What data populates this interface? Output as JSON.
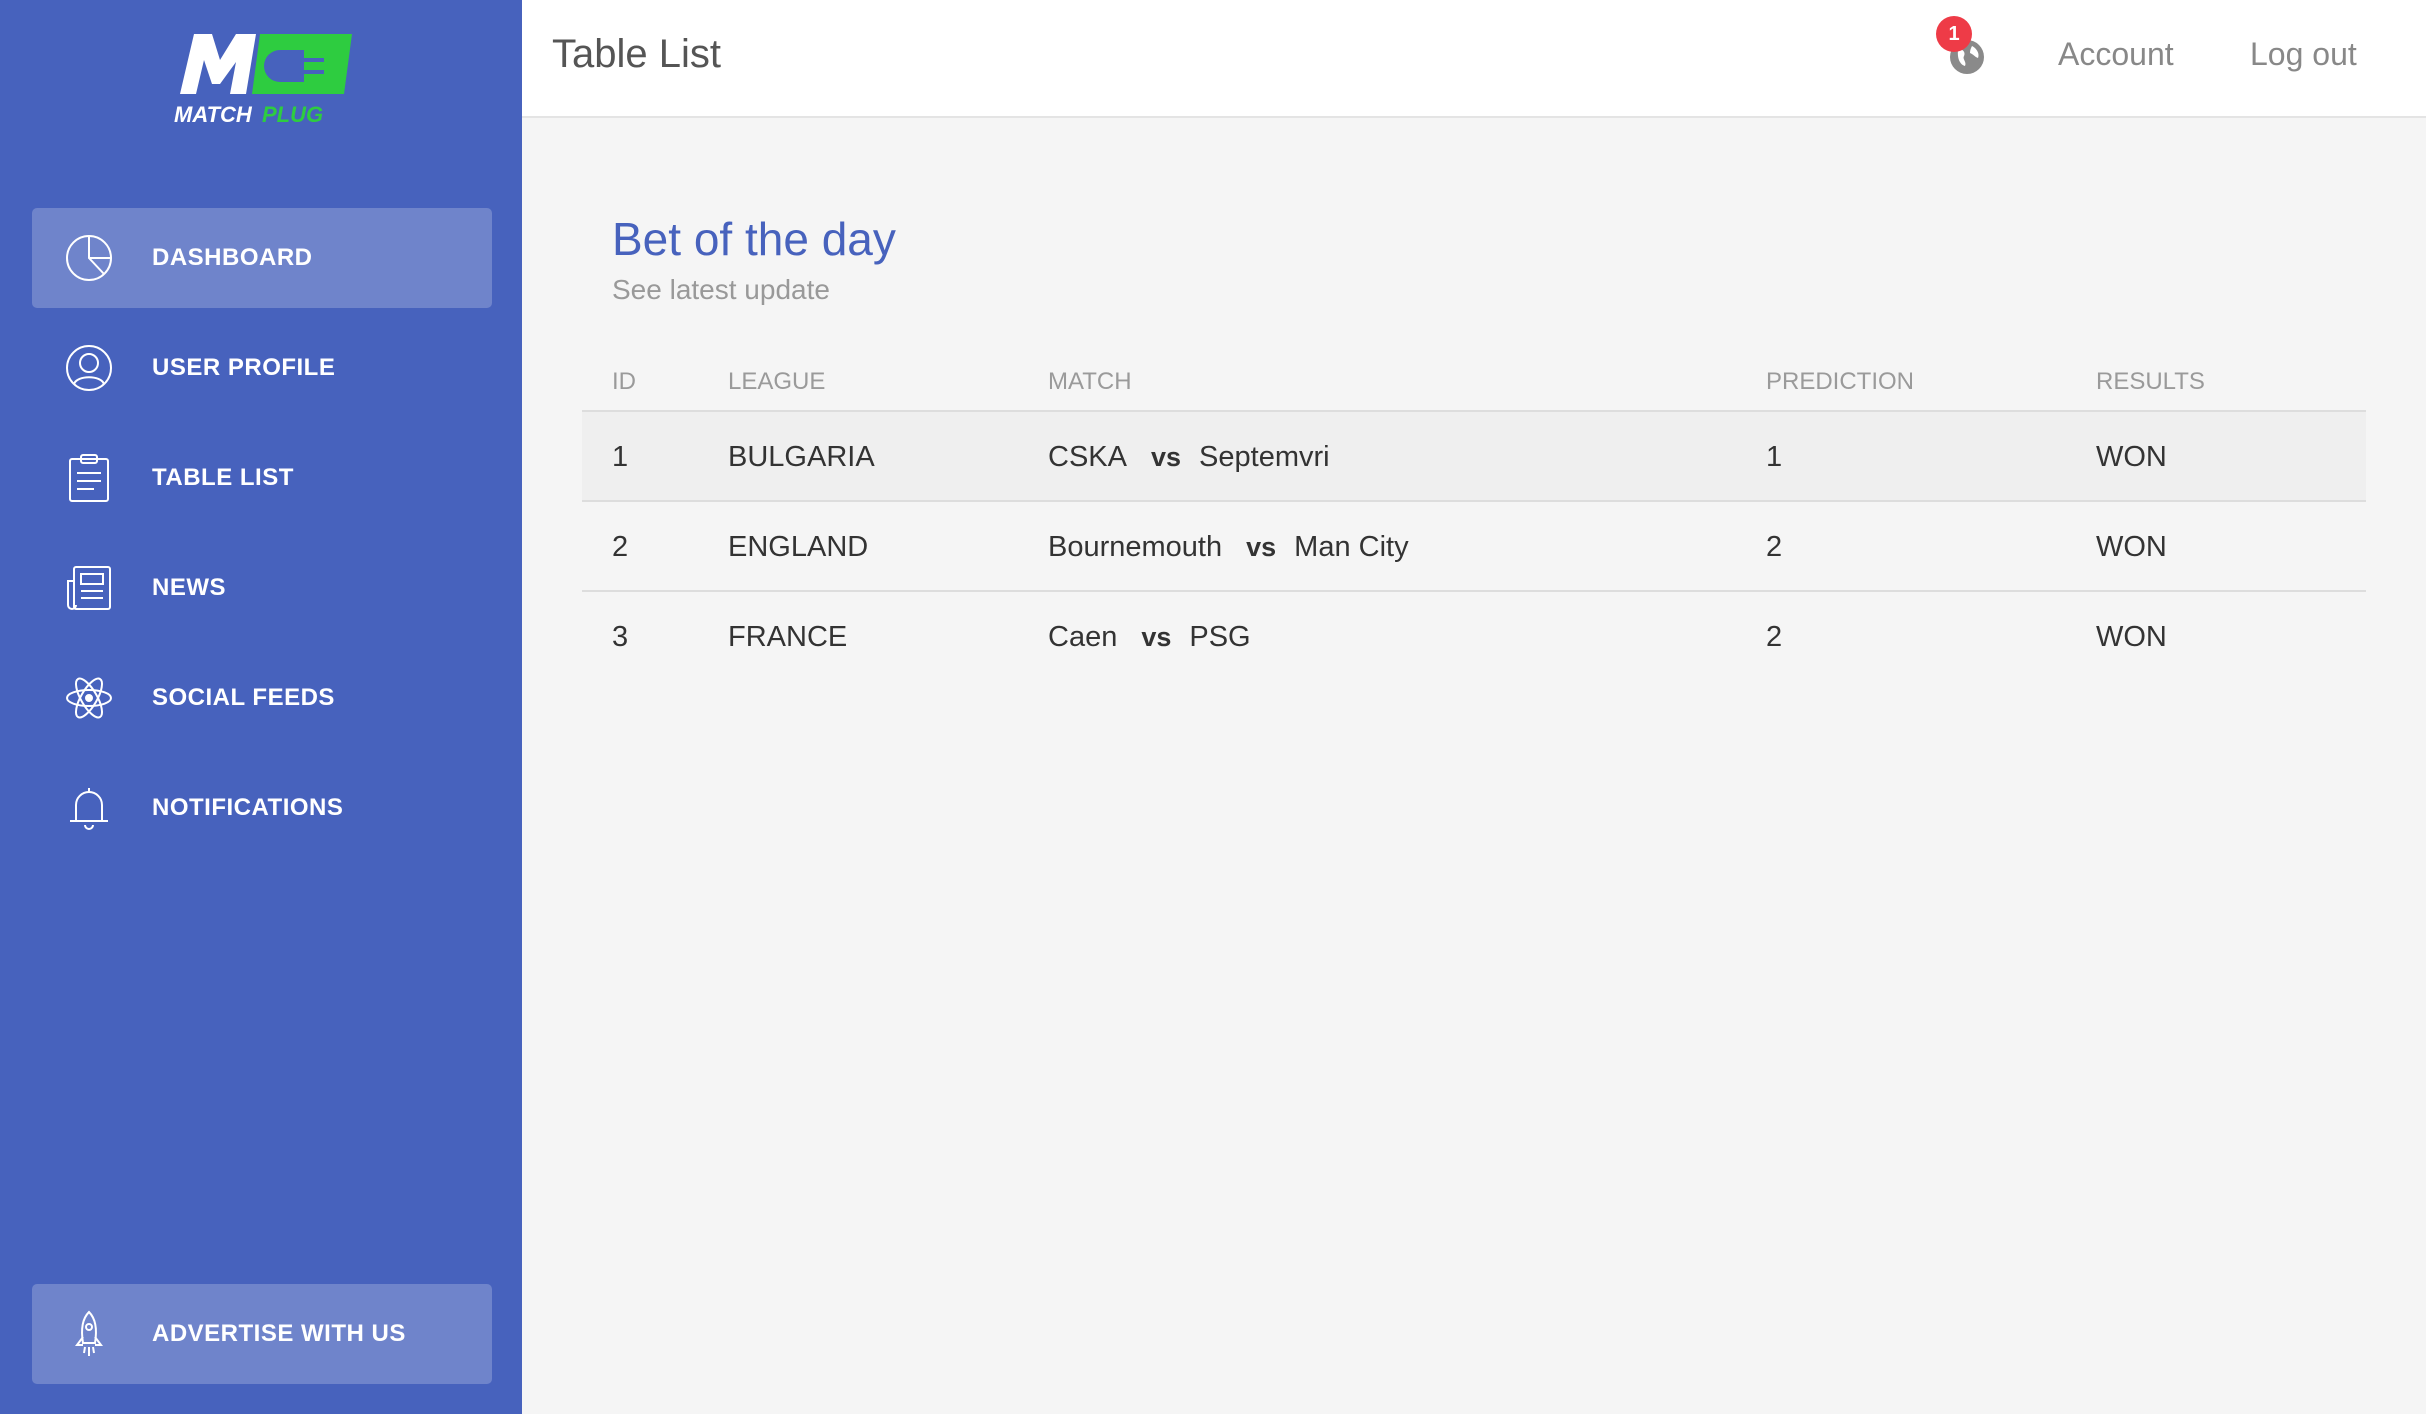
{
  "brand": {
    "logo_text": "MATCHPLUG",
    "logo_text_a": "MATCH",
    "logo_text_b": "PLUG",
    "logo_mark": "M",
    "colors": {
      "primary": "#4762bd",
      "accent": "#2ecc40",
      "badge": "#ee3b47"
    }
  },
  "sidebar": {
    "items": [
      {
        "label": "DASHBOARD",
        "icon": "pie-chart-icon",
        "active": true
      },
      {
        "label": "USER PROFILE",
        "icon": "user-icon",
        "active": false
      },
      {
        "label": "TABLE LIST",
        "icon": "clipboard-icon",
        "active": false
      },
      {
        "label": "NEWS",
        "icon": "newspaper-icon",
        "active": false
      },
      {
        "label": "SOCIAL FEEDS",
        "icon": "atom-icon",
        "active": false
      },
      {
        "label": "NOTIFICATIONS",
        "icon": "bell-icon",
        "active": false
      }
    ],
    "advertise": {
      "label": "ADVERTISE WITH US",
      "icon": "rocket-icon"
    }
  },
  "header": {
    "title": "Table List",
    "notification_count": "1",
    "notification_icon": "globe-icon",
    "account_label": "Account",
    "logout_label": "Log out"
  },
  "card": {
    "title": "Bet of the day",
    "subtitle": "See latest update"
  },
  "table": {
    "headers": [
      "ID",
      "LEAGUE",
      "MATCH",
      "PREDICTION",
      "RESULTS"
    ],
    "vs_label": "vs",
    "rows": [
      {
        "id": "1",
        "league": "BULGARIA",
        "home": "CSKA",
        "away": "Septemvri",
        "prediction": "1",
        "result": "WON"
      },
      {
        "id": "2",
        "league": "ENGLAND",
        "home": "Bournemouth",
        "away": "Man City",
        "prediction": "2",
        "result": "WON"
      },
      {
        "id": "3",
        "league": "FRANCE",
        "home": "Caen",
        "away": "PSG",
        "prediction": "2",
        "result": "WON"
      }
    ]
  }
}
